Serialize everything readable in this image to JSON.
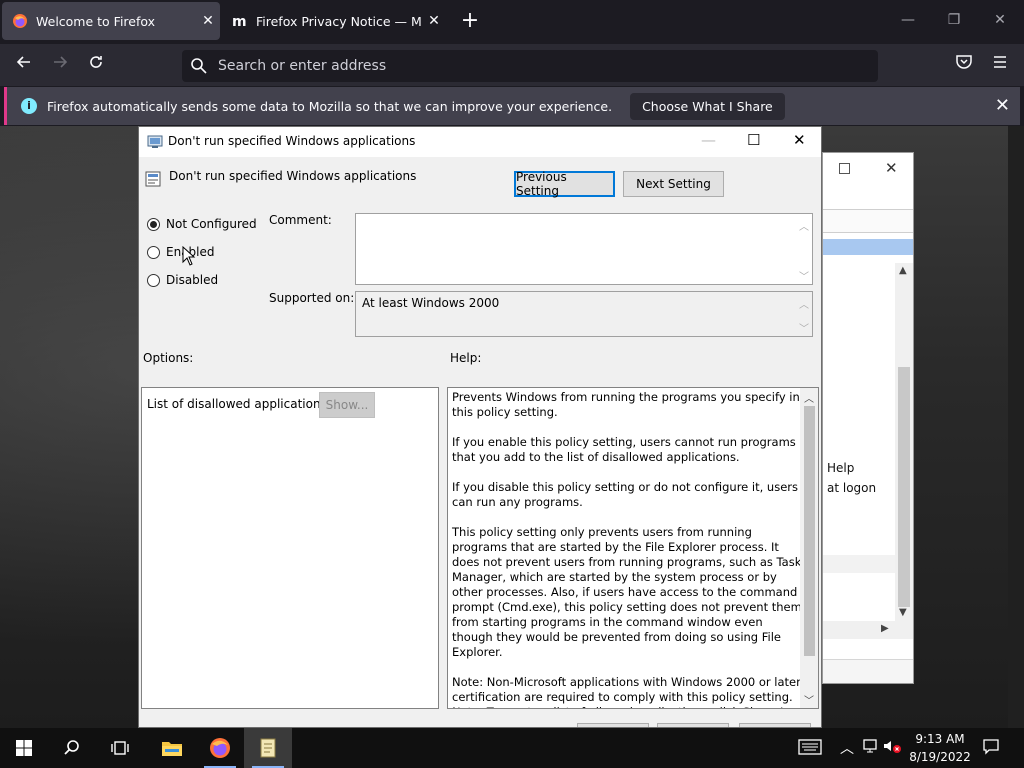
{
  "browser": {
    "tabs": [
      {
        "title": "Welcome to Firefox",
        "active": true
      },
      {
        "title": "Firefox Privacy Notice — Mozilla",
        "active": false
      }
    ],
    "url_placeholder": "Search or enter address",
    "notification": {
      "message": "Firefox automatically sends some data to Mozilla so that we can improve your experience.",
      "button": "Choose What I Share"
    }
  },
  "background_window": {
    "text1": "Help",
    "text2": "at logon"
  },
  "dialog": {
    "title": "Don't run specified Windows applications",
    "heading": "Don't run specified Windows applications",
    "prev_button": "Previous Setting",
    "next_button": "Next Setting",
    "radios": [
      {
        "label": "Not Configured",
        "checked": true
      },
      {
        "label": "Enabled",
        "checked": false
      },
      {
        "label": "Disabled",
        "checked": false
      }
    ],
    "comment_label": "Comment:",
    "comment_value": "",
    "supported_label": "Supported on:",
    "supported_value": "At least Windows 2000",
    "options_label": "Options:",
    "help_label": "Help:",
    "option_item": "List of disallowed applications",
    "show_button": "Show...",
    "help_paragraphs": [
      "Prevents Windows from running the programs you specify in this policy setting.",
      "If you enable this policy setting, users cannot run programs that you add to the list of disallowed applications.",
      "If you disable this policy setting or do not configure it, users can run any programs.",
      "This policy setting only prevents users from running programs that are started by the File Explorer process. It does not prevent users from running programs, such as Task Manager, which are started by the system process or by other processes.  Also, if users have access to the command prompt (Cmd.exe), this policy setting does not prevent them from starting programs in the command window even though they would be prevented from doing so using File Explorer.",
      "Note: Non-Microsoft applications with Windows 2000 or later certification are required to comply with this policy setting.\nNote: To create a list of allowed applications, click Show.  In the"
    ]
  },
  "taskbar": {
    "time": "9:13 AM",
    "date": "8/19/2022"
  },
  "colors": {
    "firefox_bg": "#1c1b22",
    "accent": "#0078d7"
  }
}
